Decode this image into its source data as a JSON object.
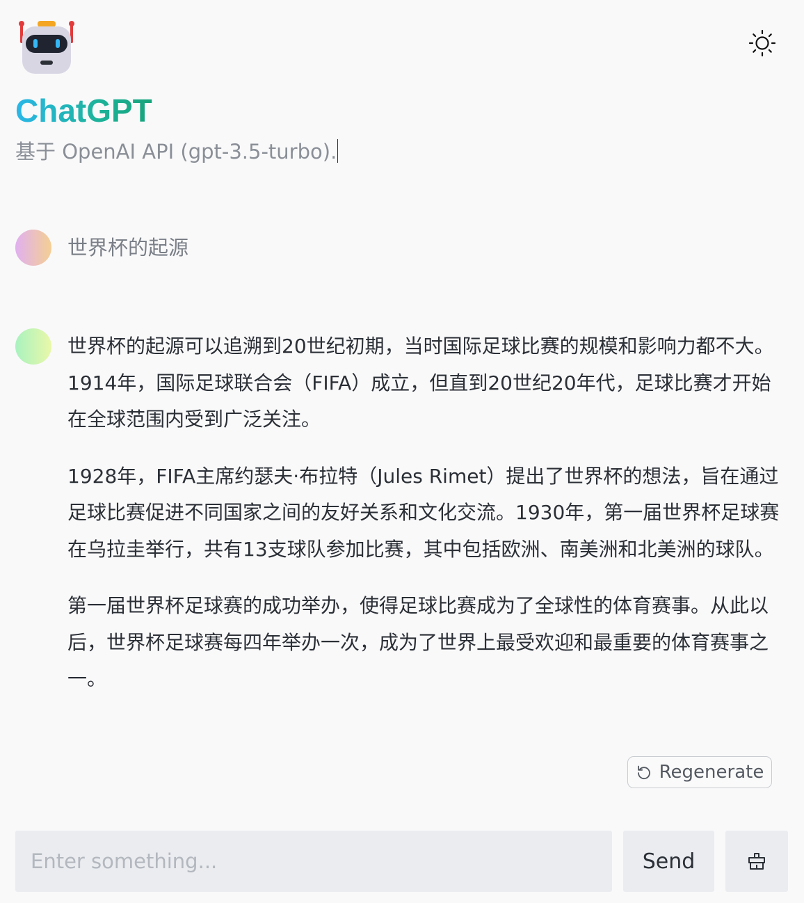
{
  "header": {
    "logo_icon": "robot-logo-icon",
    "title": "ChatGPT",
    "subtitle": "基于 OpenAI API (gpt-3.5-turbo).",
    "theme_toggle_icon": "sun-icon"
  },
  "messages": [
    {
      "role": "user",
      "text": "世界杯的起源"
    },
    {
      "role": "assistant",
      "paragraphs": [
        "世界杯的起源可以追溯到20世纪初期，当时国际足球比赛的规模和影响力都不大。1914年，国际足球联合会（FIFA）成立，但直到20世纪20年代，足球比赛才开始在全球范围内受到广泛关注。",
        "1928年，FIFA主席约瑟夫·布拉特（Jules Rimet）提出了世界杯的想法，旨在通过足球比赛促进不同国家之间的友好关系和文化交流。1930年，第一届世界杯足球赛在乌拉圭举行，共有13支球队参加比赛，其中包括欧洲、南美洲和北美洲的球队。",
        "第一届世界杯足球赛的成功举办，使得足球比赛成为了全球性的体育赛事。从此以后，世界杯足球赛每四年举办一次，成为了世界上最受欢迎和最重要的体育赛事之一。"
      ]
    }
  ],
  "actions": {
    "regenerate_label": "Regenerate",
    "regenerate_icon": "refresh-icon"
  },
  "composer": {
    "placeholder": "Enter something...",
    "value": "",
    "send_label": "Send",
    "clear_icon": "broom-icon"
  },
  "colors": {
    "title_gradient_start": "#2ab7e8",
    "title_gradient_end": "#16a37a",
    "input_background": "#eaecf0"
  }
}
